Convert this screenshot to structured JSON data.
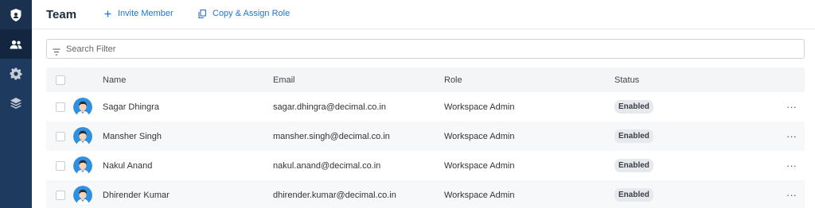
{
  "sidebar": {
    "items": [
      {
        "icon": "shield-logo-icon"
      },
      {
        "icon": "users-icon",
        "active": true
      },
      {
        "icon": "gear-icon"
      },
      {
        "icon": "layers-icon"
      }
    ]
  },
  "header": {
    "title": "Team",
    "invite_label": "Invite Member",
    "copy_label": "Copy & Assign Role"
  },
  "search": {
    "placeholder": "Search Filter",
    "value": ""
  },
  "table": {
    "columns": [
      "Name",
      "Email",
      "Role",
      "Status"
    ],
    "rows": [
      {
        "name": "Sagar Dhingra",
        "email": "sagar.dhingra@decimal.co.in",
        "role": "Workspace Admin",
        "status": "Enabled"
      },
      {
        "name": "Mansher Singh",
        "email": "mansher.singh@decimal.co.in",
        "role": "Workspace Admin",
        "status": "Enabled"
      },
      {
        "name": "Nakul Anand",
        "email": "nakul.anand@decimal.co.in",
        "role": "Workspace Admin",
        "status": "Enabled"
      },
      {
        "name": "Dhirender Kumar",
        "email": "dhirender.kumar@decimal.co.in",
        "role": "Workspace Admin",
        "status": "Enabled"
      }
    ],
    "more_glyph": "···"
  },
  "colors": {
    "sidebar": "#1f3a5f",
    "accent": "#1f74d3",
    "badge_bg": "#e7e9ed"
  }
}
